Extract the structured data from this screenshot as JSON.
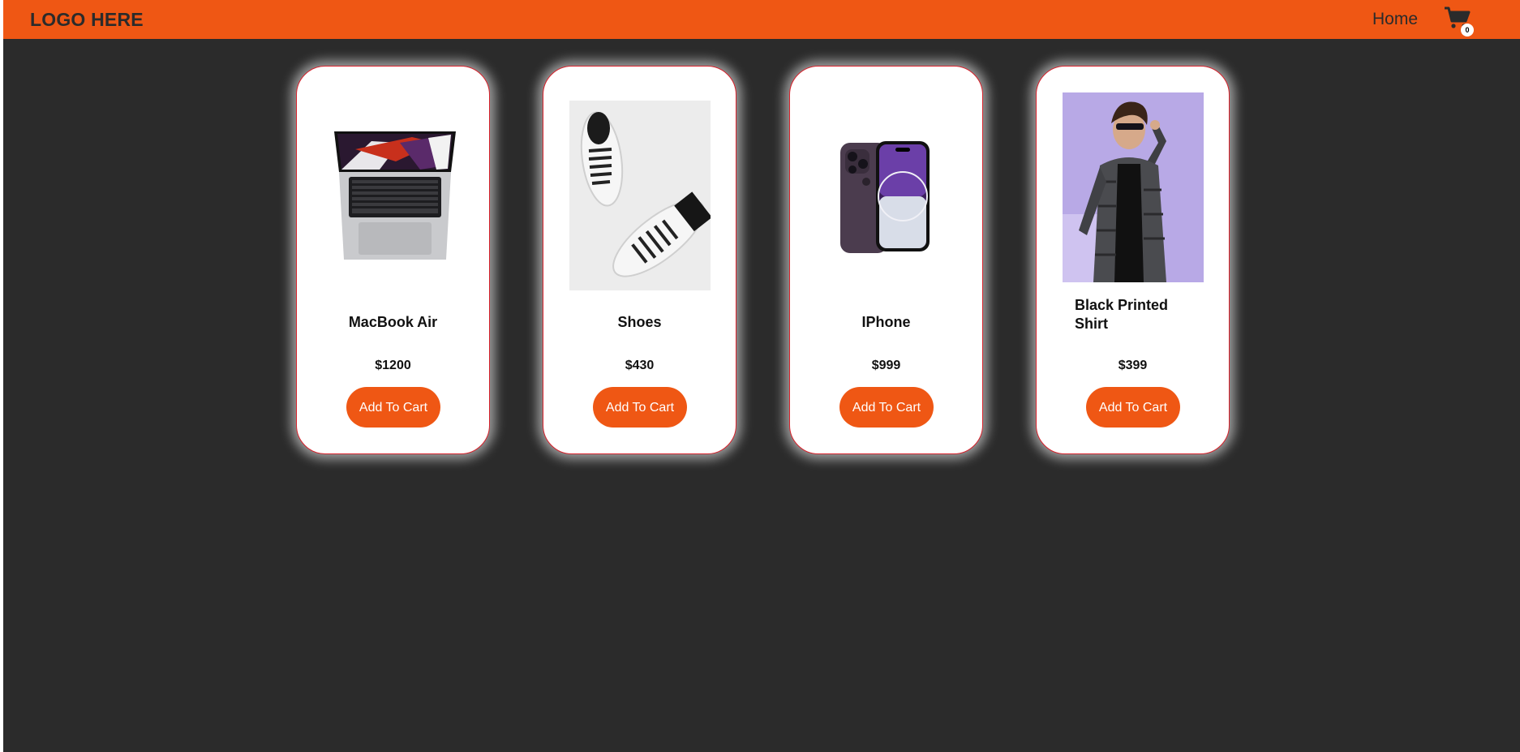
{
  "header": {
    "logo": "LOGO HERE",
    "nav_home": "Home",
    "cart_count": "0",
    "cart_icon": "shopping-cart-icon",
    "brand_color": "#ef5714",
    "background_color": "#2b2b2b"
  },
  "products": [
    {
      "title": "MacBook Air",
      "price": "$1200",
      "button": "Add To Cart",
      "image_icon": "laptop-image"
    },
    {
      "title": "Shoes",
      "price": "$430",
      "button": "Add To Cart",
      "image_icon": "sneakers-image"
    },
    {
      "title": "IPhone",
      "price": "$999",
      "button": "Add To Cart",
      "image_icon": "phone-image"
    },
    {
      "title": "Black Printed Shirt",
      "price": "$399",
      "button": "Add To Cart",
      "image_icon": "shirt-model-image"
    }
  ]
}
